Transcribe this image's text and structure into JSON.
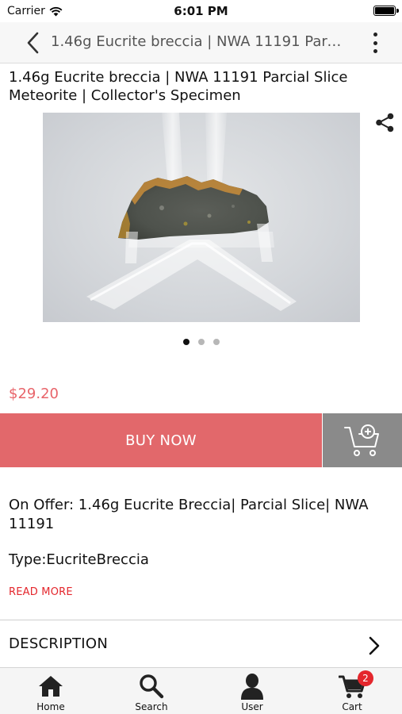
{
  "status_bar": {
    "carrier": "Carrier",
    "time": "6:01 PM"
  },
  "nav": {
    "title": "1.46g Eucrite breccia | NWA 11191 Parcial Slice Meteorite | Collector's Specimen"
  },
  "product": {
    "title": "1.46g Eucrite breccia | NWA 11191 Parcial Slice Meteorite | Collector's Specimen",
    "image_count": 3,
    "active_image_index": 0,
    "price": "$29.20",
    "buy_now_label": "BUY NOW",
    "offer_text": "On Offer: 1.46g Eucrite Breccia| Parcial Slice| NWA 11191",
    "type_text": "Type:EucriteBreccia",
    "read_more_label": "READ MORE"
  },
  "description": {
    "label": "DESCRIPTION"
  },
  "tabs": [
    {
      "label": "Home",
      "icon": "home-icon"
    },
    {
      "label": "Search",
      "icon": "search-icon"
    },
    {
      "label": "User",
      "icon": "user-icon"
    },
    {
      "label": "Cart",
      "icon": "cart-icon",
      "badge": "2"
    }
  ],
  "colors": {
    "accent": "#e2686b",
    "price": "#e8646a",
    "link": "#e4272d",
    "cart_button": "#8a8a8a",
    "badge": "#e4272d"
  }
}
